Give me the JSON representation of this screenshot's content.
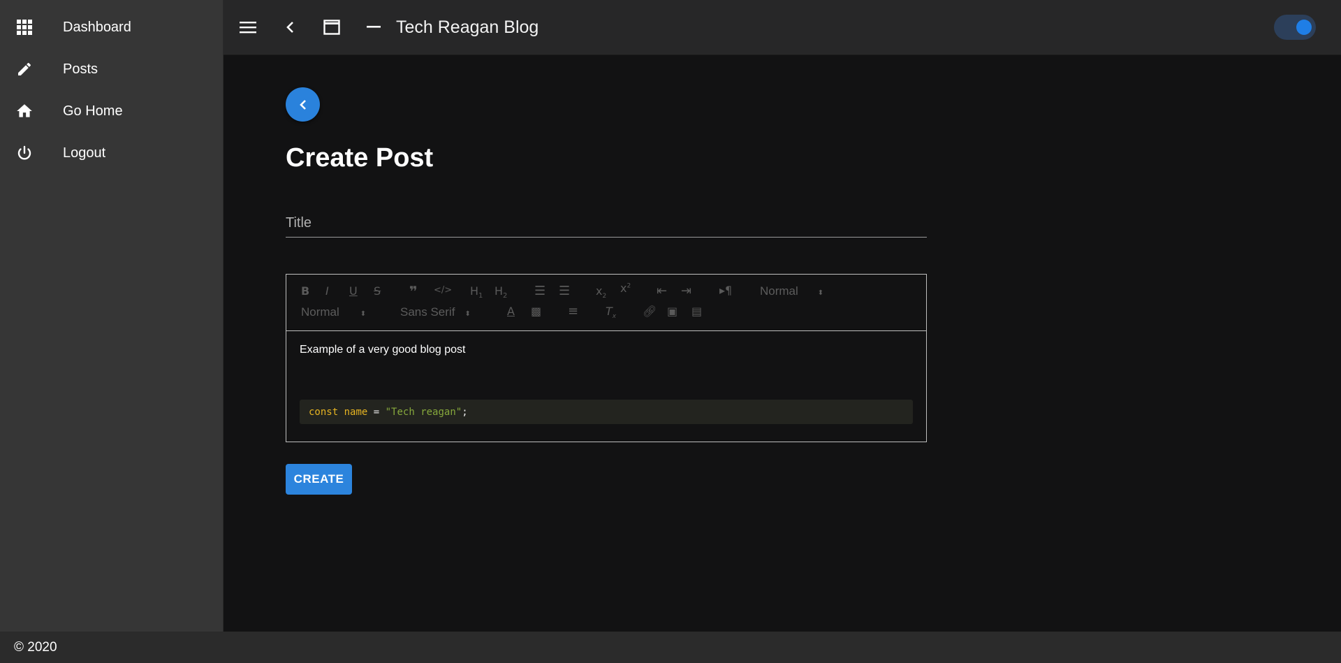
{
  "sidebar": {
    "items": [
      {
        "label": "Dashboard",
        "icon": "apps-grid-icon"
      },
      {
        "label": "Posts",
        "icon": "pencil-icon"
      },
      {
        "label": "Go Home",
        "icon": "home-icon"
      },
      {
        "label": "Logout",
        "icon": "power-icon"
      }
    ]
  },
  "topbar": {
    "title": "Tech Reagan Blog",
    "theme_toggle_on": true
  },
  "main": {
    "heading": "Create Post",
    "title_field": {
      "placeholder": "Title",
      "value": ""
    },
    "editor": {
      "toolbar": {
        "header_select": "Normal",
        "size_select": "Normal",
        "font_select": "Sans Serif"
      },
      "content_text": "Example of a very good blog post",
      "code": {
        "keyword": "const",
        "identifier": "name",
        "operator": "=",
        "string": "\"Tech reagan\"",
        "terminator": ";"
      }
    },
    "create_label": "CREATE"
  },
  "footer": {
    "text": "© 2020"
  },
  "colors": {
    "accent": "#2c84dd",
    "background": "#121213",
    "sidebar": "#363636",
    "topbar": "#272728"
  }
}
